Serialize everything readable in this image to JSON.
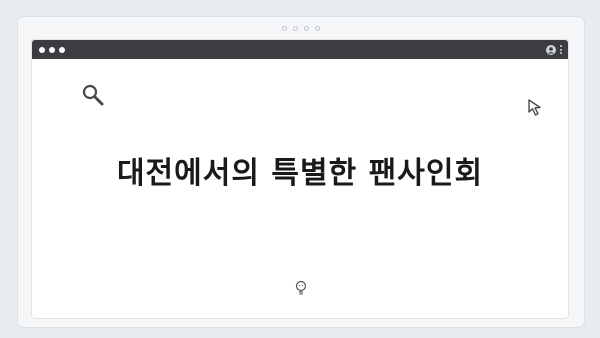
{
  "page": {
    "title": "대전에서의 특별한 팬사인회"
  },
  "icons": {
    "top_dots": "carousel-dots",
    "window_controls": "window-dots",
    "profile": "user-icon",
    "menu": "kebab-menu-icon",
    "search": "search-icon",
    "cursor": "pointer-cursor-icon",
    "idea": "lightbulb-icon"
  },
  "colors": {
    "background": "#e9ecef",
    "titlebar": "#3b3d41",
    "content": "#ffffff",
    "text": "#1a1a1a"
  }
}
